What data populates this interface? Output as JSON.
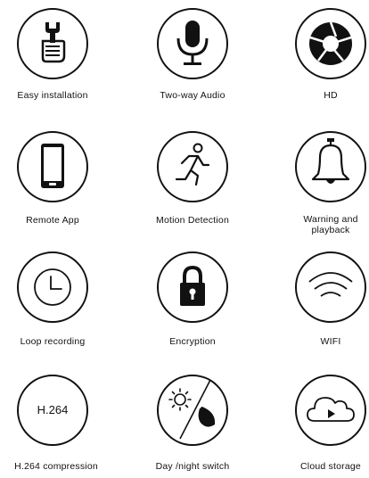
{
  "features": [
    {
      "label": "Easy installation",
      "icon": "wrench-hand-icon"
    },
    {
      "label": "Two-way Audio",
      "icon": "microphone-icon"
    },
    {
      "label": "HD",
      "icon": "aperture-icon"
    },
    {
      "label": "Remote App",
      "icon": "smartphone-icon"
    },
    {
      "label": "Motion Detection",
      "icon": "running-person-icon"
    },
    {
      "label": "Warning and playback",
      "icon": "bell-icon"
    },
    {
      "label": "Loop recording",
      "icon": "clock-icon"
    },
    {
      "label": "Encryption",
      "icon": "padlock-icon"
    },
    {
      "label": "WIFI",
      "icon": "wifi-icon"
    },
    {
      "label": "H.264 compression",
      "icon": "h264-icon",
      "icon_text": "H.264"
    },
    {
      "label": "Day /night switch",
      "icon": "sun-moon-icon"
    },
    {
      "label": "Cloud storage",
      "icon": "cloud-play-icon"
    }
  ]
}
